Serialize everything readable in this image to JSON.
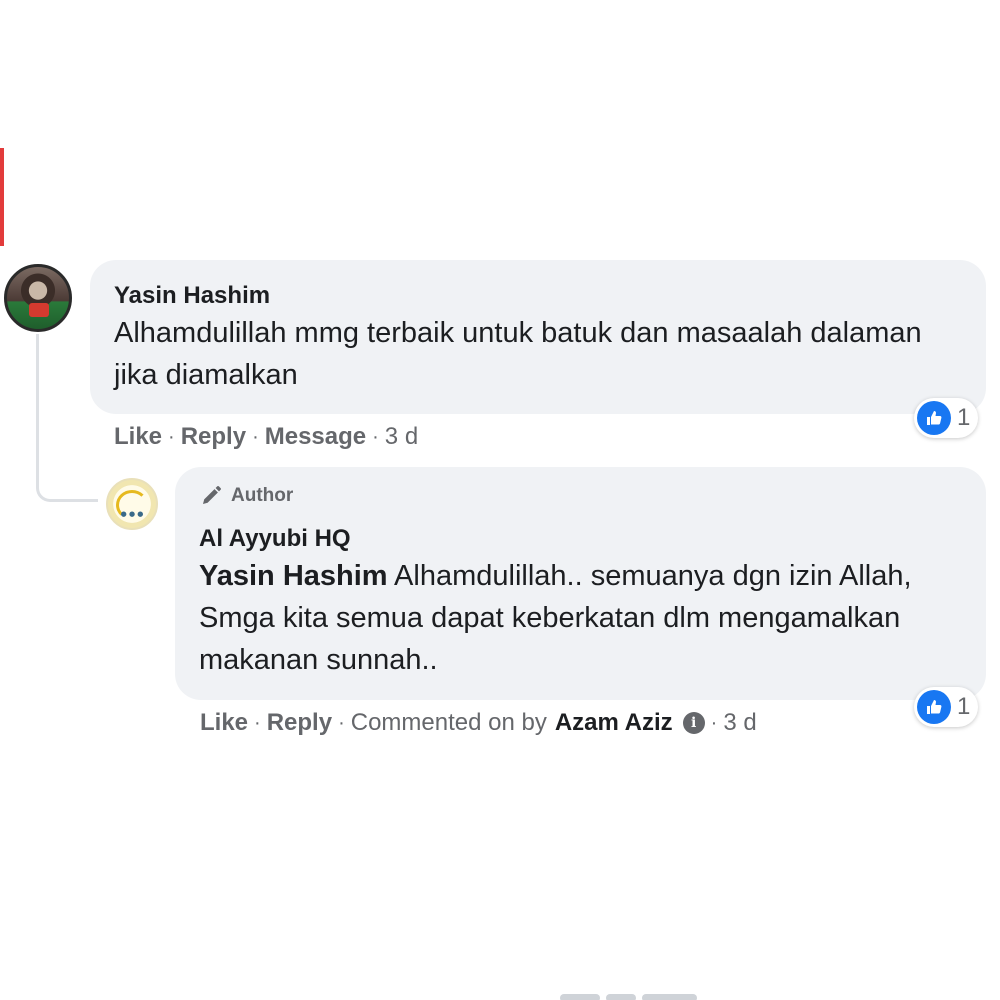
{
  "colors": {
    "bubble_bg": "#f0f2f5",
    "like_blue": "#1877f2",
    "meta_gray": "#65676b",
    "text_dark": "#1c1e21"
  },
  "comment": {
    "author": "Yasin Hashim",
    "text": "Alhamdulillah mmg terbaik untuk batuk dan masaalah dalaman jika diamalkan",
    "reaction_icon": "like-icon",
    "reaction_count": "1",
    "actions": {
      "like": "Like",
      "reply": "Reply",
      "message": "Message",
      "time": "3 d",
      "separator": "·"
    }
  },
  "reply": {
    "badge_icon": "pencil-icon",
    "badge_label": "Author",
    "author": "Al Ayyubi HQ",
    "mention": "Yasin Hashim",
    "text": " Alhamdulillah.. semuanya dgn izin Allah, Smga kita semua dapat keberkatan dlm mengamalkan makanan sunnah..",
    "reaction_icon": "like-icon",
    "reaction_count": "1",
    "actions": {
      "like": "Like",
      "reply": "Reply",
      "commented_on_by": "Commented on by",
      "by_name": "Azam Aziz",
      "info_icon": "info-icon",
      "time": "3 d",
      "separator": "·"
    }
  }
}
